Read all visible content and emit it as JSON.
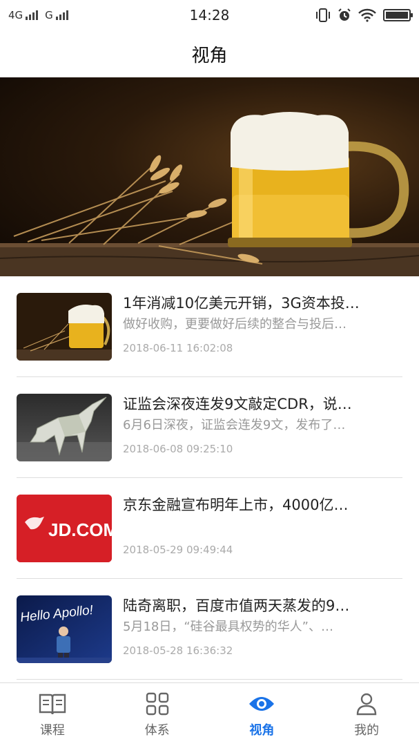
{
  "status_bar": {
    "network_1": "4G",
    "network_2": "G",
    "time": "14:28"
  },
  "nav": {
    "title": "视角"
  },
  "banner": {
    "icon": "beer-mug-image"
  },
  "articles": [
    {
      "title": "1年消减10亿美元开销，3G资本投…",
      "summary": "做好收购，更要做好后续的整合与投后…",
      "date": "2018-06-11 16:02:08",
      "thumb_icon": "beer-thumbnail"
    },
    {
      "title": "证监会深夜连发9文敲定CDR，说…",
      "summary": "6月6日深夜，证监会连发9文，发布了…",
      "date": "2018-06-08 09:25:10",
      "thumb_icon": "unicorn-origami-thumbnail"
    },
    {
      "title": "京东金融宣布明年上市，4000亿…",
      "summary": "",
      "date": "2018-05-29 09:49:44",
      "thumb_icon": "jd-logo-thumbnail",
      "thumb_text": "JD.COM 京东"
    },
    {
      "title": "陆奇离职，百度市值两天蒸发的9…",
      "summary": "5月18日，“硅谷最具权势的华人”、…",
      "date": "2018-05-28 16:36:32",
      "thumb_icon": "hello-apollo-thumbnail",
      "thumb_text": "Hello Apollo!"
    }
  ],
  "tabs": [
    {
      "label": "课程",
      "icon": "book-icon",
      "active": false
    },
    {
      "label": "体系",
      "icon": "grid-icon",
      "active": false
    },
    {
      "label": "视角",
      "icon": "eye-icon",
      "active": true
    },
    {
      "label": "我的",
      "icon": "person-icon",
      "active": false
    }
  ],
  "colors": {
    "accent": "#1a73e8",
    "divider": "#dddddd",
    "jd_red": "#d61f26"
  }
}
